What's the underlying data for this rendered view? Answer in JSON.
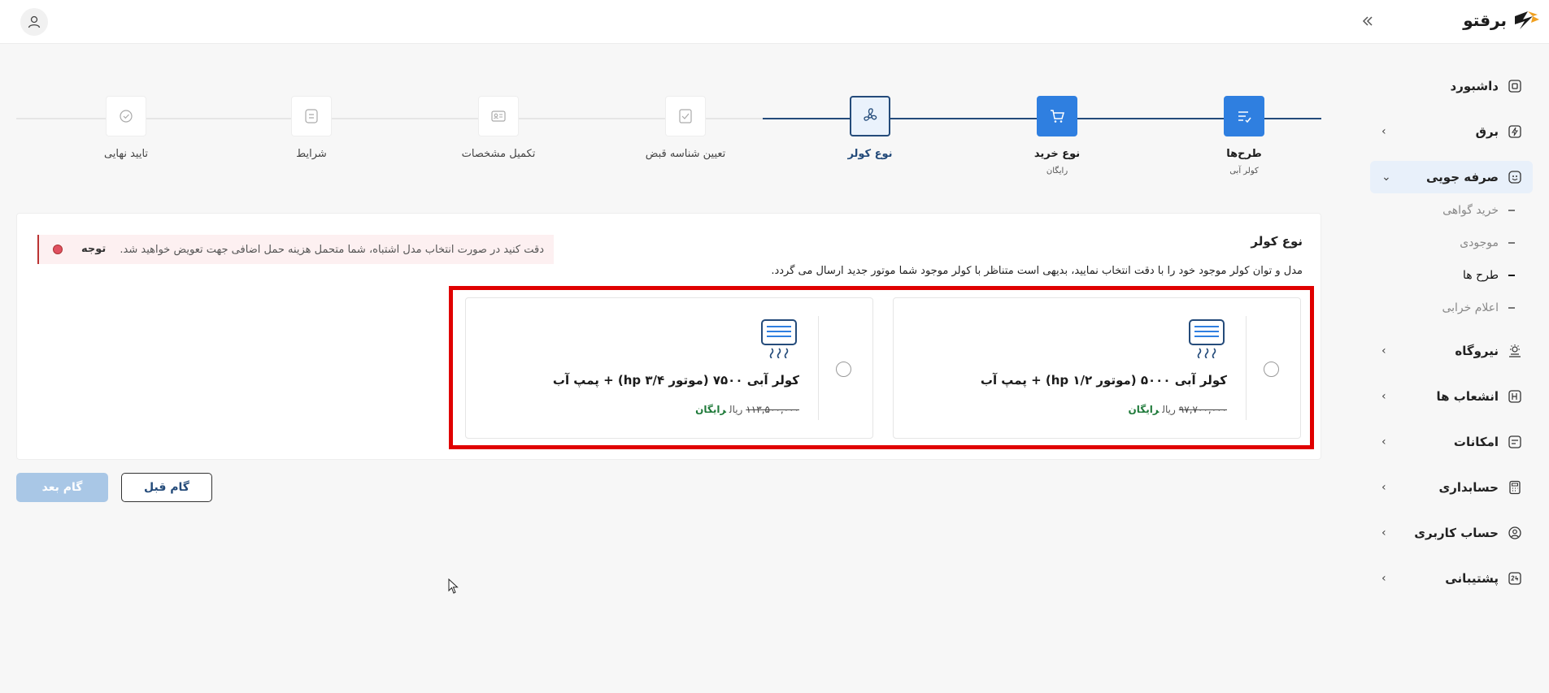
{
  "app": {
    "brand": "برقتو"
  },
  "sidebar": {
    "items": [
      {
        "label": "داشبورد",
        "icon": "dashboard-icon"
      },
      {
        "label": "برق",
        "icon": "electricity-icon"
      },
      {
        "label": "صرفه جویی",
        "icon": "saving-icon"
      },
      {
        "label": "نیروگاه",
        "icon": "power-plant-icon"
      },
      {
        "label": "انشعاب ها",
        "icon": "branch-icon"
      },
      {
        "label": "امکانات",
        "icon": "features-icon"
      },
      {
        "label": "حسابداری",
        "icon": "accounting-icon"
      },
      {
        "label": "حساب کاربری",
        "icon": "user-account-icon"
      },
      {
        "label": "پشتیبانی",
        "icon": "support-24-icon"
      }
    ],
    "sub_items": [
      {
        "label": "خرید گواهی"
      },
      {
        "label": "موجودی"
      },
      {
        "label": "طرح ها"
      },
      {
        "label": "اعلام خرابی"
      }
    ]
  },
  "steps": [
    {
      "label": "طرح‌ها",
      "sub": "کولر آبی"
    },
    {
      "label": "نوع خرید",
      "sub": "رایگان"
    },
    {
      "label": "نوع کولر"
    },
    {
      "label": "تعیین شناسه قبض"
    },
    {
      "label": "تکمیل مشخصات"
    },
    {
      "label": "شرایط"
    },
    {
      "label": "تایید نهایی"
    }
  ],
  "panel": {
    "title": "نوع کولر",
    "description": "مدل و توان کولر موجود خود را با دقت انتخاب نمایید، بدیهی است متناظر با کولر موجود شما موتور جدید ارسال می گردد.",
    "alert_label": "توجه",
    "alert_message": "دقت کنید در صورت انتخاب مدل اشتباه، شما متحمل هزینه حمل اضافی جهت تعویض خواهید شد."
  },
  "cards": [
    {
      "title": "کولر آبی ۵۰۰۰ (موتور ۱/۲ hp) + پمپ آب",
      "old_price": "۹۷,۷۰۰,۰۰۰",
      "unit": "ریال",
      "badge": "رایگان"
    },
    {
      "title": "کولر آبی ۷۵۰۰ (موتور ۳/۴ hp) + پمپ آب",
      "old_price": "۱۱۳,۵۰۰,۰۰۰",
      "unit": "ریال",
      "badge": "رایگان"
    }
  ],
  "buttons": {
    "prev": "گام قبل",
    "next": "گام بعد"
  },
  "colors": {
    "primary": "#2f7fe0",
    "dark_blue": "#244b7a",
    "highlight": "#e00000",
    "free": "#1f7a3a"
  }
}
